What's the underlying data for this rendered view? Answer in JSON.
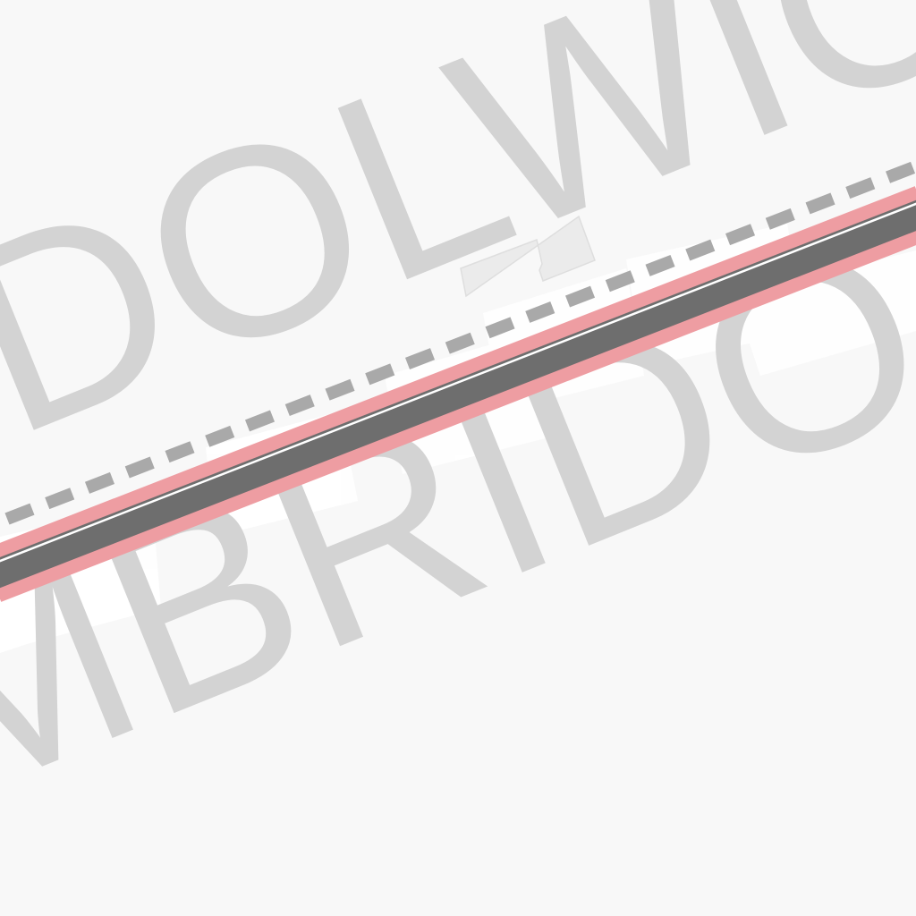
{
  "map": {
    "labels": {
      "upper_place": "DOLWIC",
      "lower_place": "MBRIDO"
    },
    "colors": {
      "background": "#f8f8f8",
      "label_text": "#d3d3d3",
      "road_casing": "#ee9da2",
      "road_fill": "#6e6e6e",
      "road_edge": "#ffffff",
      "rail_dashes": "#a9a9a9",
      "building_fill": "#ebebeb",
      "building_stroke": "#dedede",
      "light_patches": "#ffffff"
    }
  }
}
